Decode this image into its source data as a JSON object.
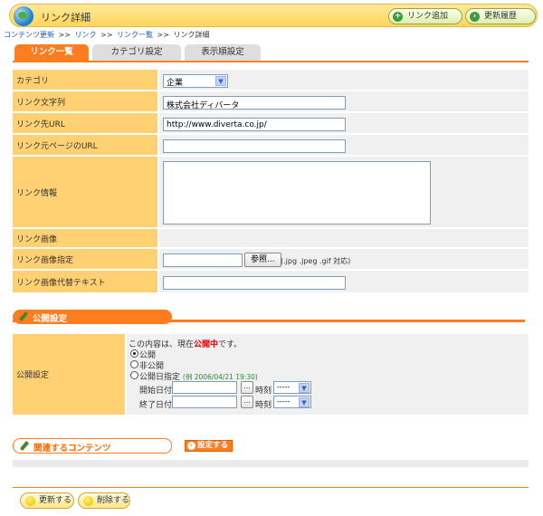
{
  "header": {
    "title": "リンク詳細",
    "add_link_button": "リンク追加",
    "history_button": "更新履歴"
  },
  "breadcrumb": {
    "items": [
      "コンテンツ更新",
      "リンク",
      "リンク一覧"
    ],
    "separator": ">>",
    "current": "リンク詳細"
  },
  "tabs": [
    {
      "label": "リンク一覧",
      "active": true
    },
    {
      "label": "カテゴリ設定",
      "active": false
    },
    {
      "label": "表示順設定",
      "active": false
    }
  ],
  "form": {
    "category_label": "カテゴリ",
    "category_value": "企業",
    "link_text_label": "リンク文字列",
    "link_text_value": "株式会社ディバータ",
    "link_url_label": "リンク先URL",
    "link_url_value": "http://www.diverta.co.jp/",
    "source_url_label": "リンク元ページのURL",
    "source_url_value": "",
    "link_info_label": "リンク情報",
    "link_image_label": "リンク画像",
    "image_spec_label": "リンク画像指定",
    "browse_button": "参照...",
    "image_types_note": "(.jpg .jpeg .gif 対応)",
    "alt_text_label": "リンク画像代替テキスト",
    "alt_text_value": ""
  },
  "publish": {
    "section_title": "公開設定",
    "label": "公開設定",
    "status_prefix": "この内容は、現在",
    "status_value": "公開中",
    "status_suffix": "です。",
    "option_public": "公開",
    "option_private": "非公開",
    "option_scheduled": "公開日指定",
    "example": "(例 2006/04/21 19:30)",
    "start_label": "開始日付",
    "end_label": "終了日付",
    "time_label": "時刻",
    "date_button": "...",
    "time_placeholder": "-----"
  },
  "related": {
    "section_title": "関連するコンテンツ",
    "set_button": "設定する"
  },
  "footer": {
    "update_button": "更新する",
    "delete_button": "削除する"
  },
  "colors": {
    "accent_orange": "#ff7c1f",
    "label_bg": "#ffd173",
    "header_yellow": "#ffd65a",
    "status_red": "#e00000",
    "link_blue": "#1b58b8"
  }
}
